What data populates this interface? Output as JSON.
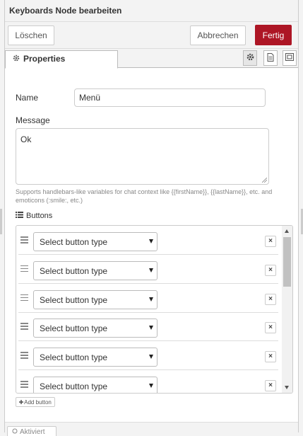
{
  "tray": {
    "title": "Keyboards Node bearbeiten",
    "delete_label": "Löschen",
    "cancel_label": "Abbrechen",
    "done_label": "Fertig"
  },
  "tabs": {
    "properties_label": "Properties",
    "icons": [
      "gear-icon",
      "file-text-icon",
      "window-icon"
    ]
  },
  "form": {
    "name_label": "Name",
    "name_value": "Menü",
    "message_label": "Message",
    "message_value": "Ok",
    "hint_text": "Supports handlebars-like variables for chat context like {{firstName}}, {{lastName}}, etc. and emoticons (:smile:, etc.)",
    "buttons_label": "Buttons"
  },
  "buttons": {
    "select_placeholder": "Select button type",
    "rows": [
      {
        "type": "Select button type"
      },
      {
        "type": "Select button type"
      },
      {
        "type": "Select button type"
      },
      {
        "type": "Select button type"
      },
      {
        "type": "Select button type"
      },
      {
        "type": "Select button type"
      }
    ],
    "remove_label": "×",
    "add_label": "Add button"
  },
  "footer": {
    "button_label": "Aktiviert"
  },
  "colors": {
    "primary": "#ad1625",
    "border": "#cccccc",
    "hint": "#888888"
  }
}
